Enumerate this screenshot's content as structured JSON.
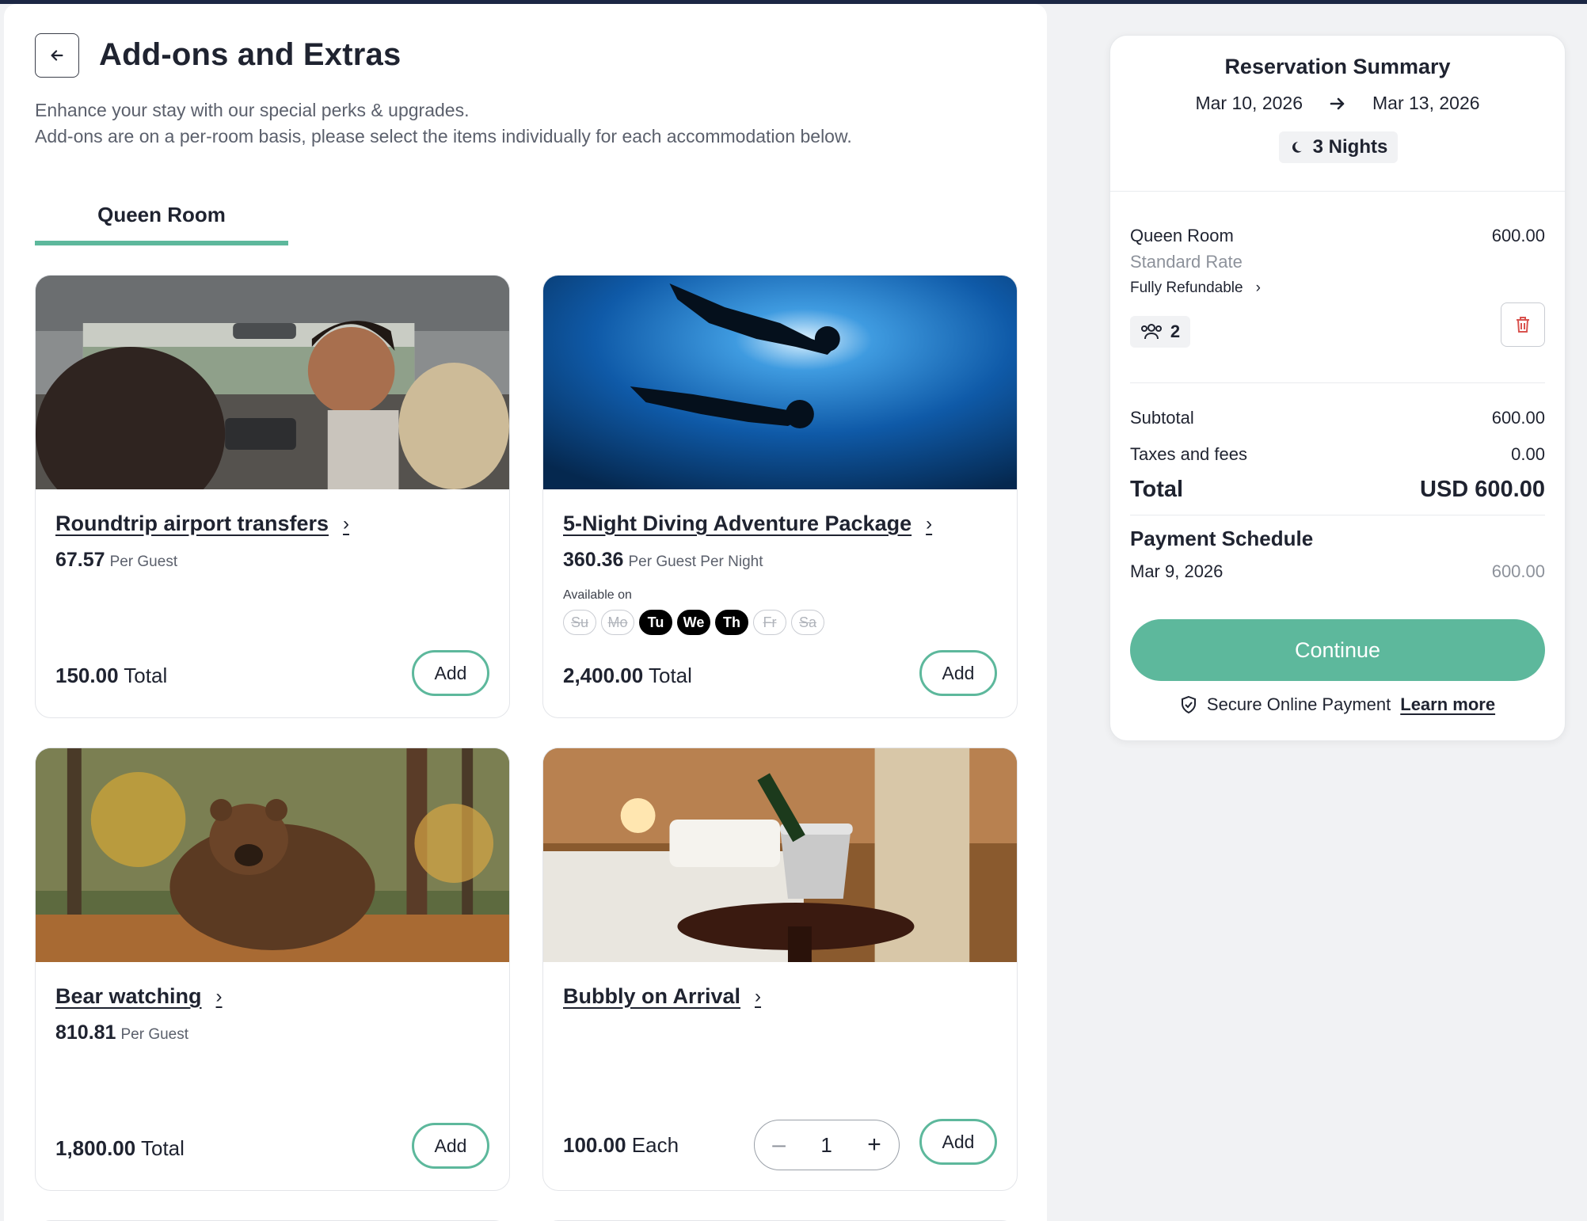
{
  "header": {
    "title": "Add-ons and Extras",
    "intro_line1": "Enhance your stay with our special perks & upgrades.",
    "intro_line2": "Add-ons are on a per-room basis, please select the items individually for each accommodation below."
  },
  "tabs": [
    {
      "label": "Queen Room",
      "active": true
    }
  ],
  "addons": [
    {
      "title": "Roundtrip airport transfers",
      "price": "67.57",
      "unit": "Per Guest",
      "total_value": "150.00",
      "total_label": "Total",
      "add_label": "Add",
      "image": "car-interior-photo"
    },
    {
      "title": "5-Night Diving Adventure Package",
      "price": "360.36",
      "unit": "Per Guest Per Night",
      "available_label": "Available on",
      "days": [
        {
          "label": "Su",
          "on": false
        },
        {
          "label": "Mo",
          "on": false
        },
        {
          "label": "Tu",
          "on": true
        },
        {
          "label": "We",
          "on": true
        },
        {
          "label": "Th",
          "on": true
        },
        {
          "label": "Fr",
          "on": false
        },
        {
          "label": "Sa",
          "on": false
        }
      ],
      "total_value": "2,400.00",
      "total_label": "Total",
      "add_label": "Add",
      "image": "scuba-divers-photo"
    },
    {
      "title": "Bear watching",
      "price": "810.81",
      "unit": "Per Guest",
      "total_value": "1,800.00",
      "total_label": "Total",
      "add_label": "Add",
      "image": "brown-bear-photo"
    },
    {
      "title": "Bubbly on Arrival",
      "total_value": "100.00",
      "total_label": "Each",
      "quantity": "1",
      "add_label": "Add",
      "image": "champagne-bucket-photo"
    }
  ],
  "summary": {
    "title": "Reservation Summary",
    "check_in": "Mar 10, 2026",
    "check_out": "Mar 13, 2026",
    "nights": "3 Nights",
    "room_name": "Queen Room",
    "room_price": "600.00",
    "rate_name": "Standard Rate",
    "refund_label": "Fully Refundable",
    "guests": "2",
    "subtotal_label": "Subtotal",
    "subtotal": "600.00",
    "taxes_label": "Taxes and fees",
    "taxes": "0.00",
    "total_label": "Total",
    "total": "USD 600.00",
    "schedule_title": "Payment Schedule",
    "schedule_date": "Mar 9, 2026",
    "schedule_amount": "600.00",
    "continue_label": "Continue",
    "secure_label": "Secure Online Payment",
    "learn_more": "Learn more"
  },
  "colors": {
    "accent": "#5db89c",
    "text": "#1f2330",
    "muted": "#8d929b",
    "topbar": "#1c2744"
  }
}
